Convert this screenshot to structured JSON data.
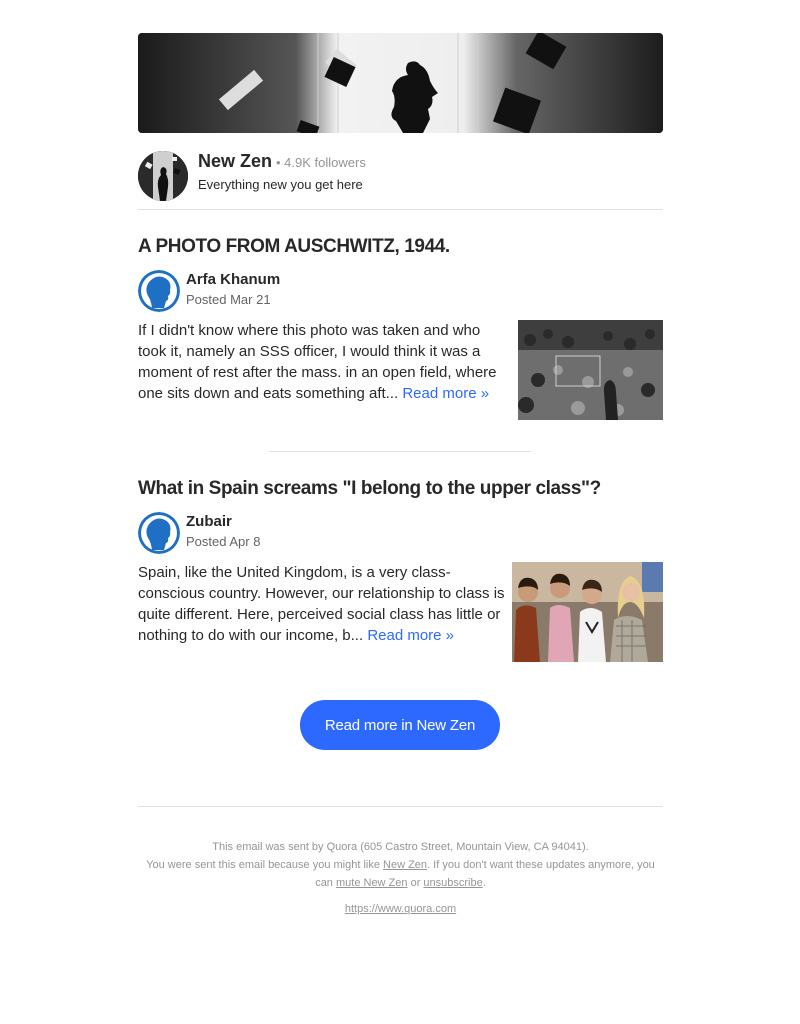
{
  "space": {
    "name": "New Zen",
    "followers": "• 4.9K followers",
    "description": "Everything new you get here"
  },
  "posts": [
    {
      "title": "A PHOTO FROM AUSCHWITZ, 1944.",
      "author": "Arfa Khanum",
      "date": "Posted Mar 21",
      "excerpt": "If I didn't know where this photo was taken and who took it, namely an SSS officer, I would think it was a moment of rest after the mass. in an open field, where one sits down and eats something aft...",
      "read_more": "Read more »"
    },
    {
      "title": "What in Spain screams \"I belong to the upper class\"?",
      "author": "Zubair",
      "date": "Posted Apr 8",
      "excerpt": "Spain, like the United Kingdom, is a very class-conscious country. However, our relationship to class is quite different. Here, perceived social class has little or nothing to do with our income, b...",
      "read_more": "Read more »"
    }
  ],
  "cta": {
    "label": "Read more in New Zen"
  },
  "footer": {
    "line1": "This email was sent by Quora (605 Castro Street, Mountain View, CA 94041).",
    "line2_a": "You were sent this email because you might like ",
    "line2_link": "New Zen",
    "line2_b": ". If you don't want these updates anymore, you can ",
    "mute_link": "mute New Zen",
    "or_text": " or ",
    "unsubscribe_link": "unsubscribe",
    "period": ".",
    "url": "https://www.quora.com"
  },
  "colors": {
    "accent": "#2e69ff",
    "text": "#282829",
    "muted": "#939598",
    "divider": "#dee0e1"
  }
}
